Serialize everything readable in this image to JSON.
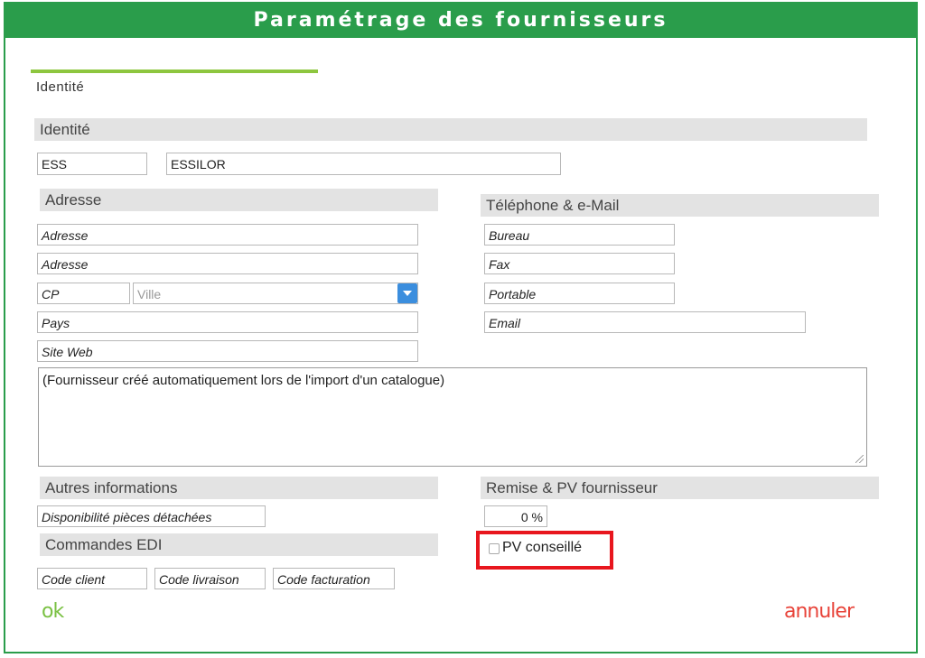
{
  "window": {
    "title": "Paramétrage des fournisseurs"
  },
  "tabs": [
    {
      "label": "Identité"
    }
  ],
  "identite": {
    "section_title": "Identité",
    "code": "ESS",
    "name": "ESSILOR"
  },
  "adresse": {
    "section_title": "Adresse",
    "address1_placeholder": "Adresse",
    "address2_placeholder": "Adresse",
    "cp_placeholder": "CP",
    "ville_placeholder": "Ville",
    "pays_placeholder": "Pays",
    "site_placeholder": "Site Web"
  },
  "contact": {
    "section_title": "Téléphone & e-Mail",
    "bureau_placeholder": "Bureau",
    "fax_placeholder": "Fax",
    "portable_placeholder": "Portable",
    "email_placeholder": "Email"
  },
  "notes": {
    "text": "(Fournisseur créé automatiquement lors de l'import d'un catalogue)"
  },
  "autres": {
    "section_title": "Autres informations",
    "dispo_placeholder": "Disponibilité pièces détachées"
  },
  "remise": {
    "section_title": "Remise & PV fournisseur",
    "value": "0 %",
    "pv_conseille_label": "PV conseillé",
    "pv_conseille_checked": false
  },
  "edi": {
    "section_title": "Commandes EDI",
    "code_client_placeholder": "Code client",
    "code_livraison_placeholder": "Code livraison",
    "code_facturation_placeholder": "Code facturation"
  },
  "actions": {
    "ok_label": "ok",
    "cancel_label": "annuler"
  },
  "colors": {
    "brand_green": "#2a9d4b",
    "accent_lime": "#8dc63f",
    "dropdown_blue": "#3b8ede",
    "highlight_red": "#e8161e",
    "cancel_red": "#e8443a"
  }
}
